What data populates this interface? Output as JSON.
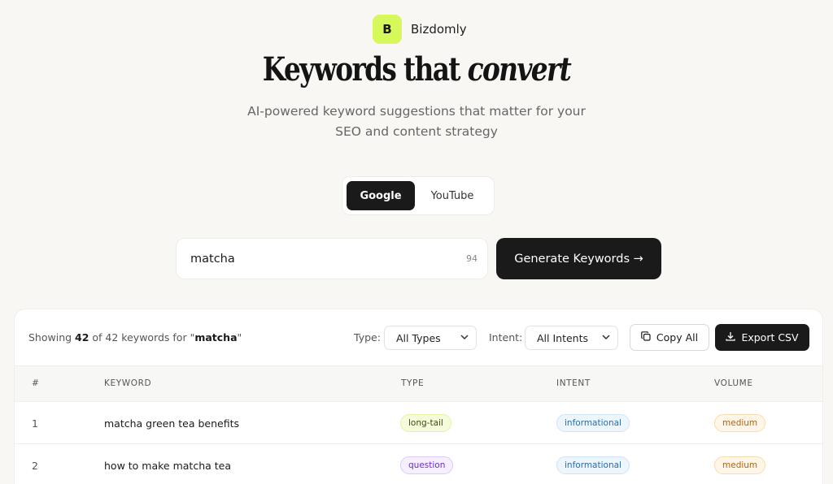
{
  "brand": {
    "logo_letter": "B",
    "name": "Bizdomly",
    "logo_color": "#d6f85a"
  },
  "hero": {
    "title_main": "Keywords that",
    "title_emphasis": "convert",
    "subtitle_line1": "AI-powered keyword suggestions that matter for your",
    "subtitle_line2": "SEO and content strategy"
  },
  "platform_toggle": {
    "options": [
      "Google",
      "YouTube"
    ],
    "selected": "Google"
  },
  "search": {
    "value": "matcha",
    "char_count": "94",
    "generate_label": "Generate Keywords →"
  },
  "results": {
    "summary_prefix": "Showing ",
    "shown": "42",
    "summary_mid": " of 42 keywords for \"",
    "query": "matcha",
    "summary_suffix": "\"",
    "type_label": "Type:",
    "type_value": "All Types",
    "intent_label": "Intent:",
    "intent_value": "All Intents",
    "copy_label": "Copy All",
    "export_label": "Export CSV",
    "columns": [
      "#",
      "KEYWORD",
      "TYPE",
      "INTENT",
      "VOLUME"
    ],
    "rows": [
      {
        "num": "1",
        "keyword": "matcha green tea benefits",
        "type": "long-tail",
        "intent": "informational",
        "volume": "medium"
      },
      {
        "num": "2",
        "keyword": "how to make matcha tea",
        "type": "question",
        "intent": "informational",
        "volume": "medium"
      }
    ]
  },
  "icons": {
    "copy": "copy-icon",
    "export": "download-icon",
    "dropdown": "chevron-down-icon"
  }
}
